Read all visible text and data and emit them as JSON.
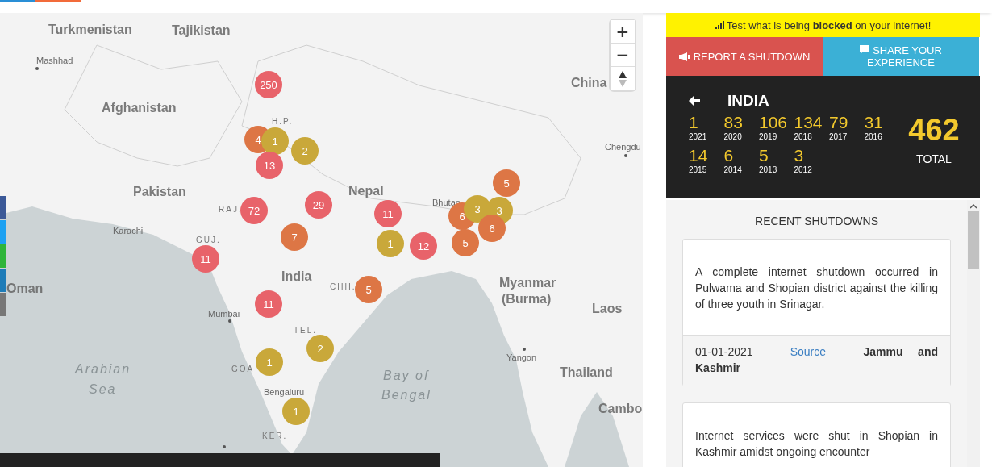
{
  "map": {
    "labels": [
      {
        "text": "Turkmenistan",
        "kind": "country"
      },
      {
        "text": "Tajikistan",
        "kind": "country"
      },
      {
        "text": "Mashhad",
        "kind": "city"
      },
      {
        "text": "Afghanistan",
        "kind": "country"
      },
      {
        "text": "China",
        "kind": "country"
      },
      {
        "text": "H.P.",
        "kind": "region"
      },
      {
        "text": "Chengdu",
        "kind": "city"
      },
      {
        "text": "Pakistan",
        "kind": "country"
      },
      {
        "text": "Nepal",
        "kind": "country"
      },
      {
        "text": "RAJ.",
        "kind": "region"
      },
      {
        "text": "Bhutan",
        "kind": "small"
      },
      {
        "text": "Karachi",
        "kind": "city"
      },
      {
        "text": "GUJ.",
        "kind": "region"
      },
      {
        "text": "India",
        "kind": "country"
      },
      {
        "text": "Oman",
        "kind": "country"
      },
      {
        "text": "CHH.",
        "kind": "region"
      },
      {
        "text": "Myanmar",
        "kind": "country"
      },
      {
        "text": "(Burma)",
        "kind": "country"
      },
      {
        "text": "Mumbai",
        "kind": "city"
      },
      {
        "text": "Laos",
        "kind": "country"
      },
      {
        "text": "TEL.",
        "kind": "region"
      },
      {
        "text": "Yangon",
        "kind": "city"
      },
      {
        "text": "Arabian",
        "kind": "sea"
      },
      {
        "text": "Sea",
        "kind": "sea"
      },
      {
        "text": "GOA",
        "kind": "region"
      },
      {
        "text": "Bay of",
        "kind": "sea"
      },
      {
        "text": "Thailand",
        "kind": "country"
      },
      {
        "text": "Bengaluru",
        "kind": "city"
      },
      {
        "text": "Bengal",
        "kind": "sea"
      },
      {
        "text": "Cambo",
        "kind": "country"
      },
      {
        "text": "KER.",
        "kind": "region"
      }
    ],
    "markers": [
      {
        "count": "250",
        "color": "#e8636a"
      },
      {
        "count": "4",
        "color": "#dd7645"
      },
      {
        "count": "1",
        "color": "#c9a83a"
      },
      {
        "count": "2",
        "color": "#c9a83a"
      },
      {
        "count": "13",
        "color": "#e8636a"
      },
      {
        "count": "5",
        "color": "#dd7645"
      },
      {
        "count": "29",
        "color": "#e8636a"
      },
      {
        "count": "72",
        "color": "#e8636a"
      },
      {
        "count": "11",
        "color": "#e8636a"
      },
      {
        "count": "6",
        "color": "#dd7645"
      },
      {
        "count": "3",
        "color": "#c9a83a"
      },
      {
        "count": "3",
        "color": "#c9a83a"
      },
      {
        "count": "6",
        "color": "#dd7645"
      },
      {
        "count": "7",
        "color": "#dd7645"
      },
      {
        "count": "1",
        "color": "#c9a83a"
      },
      {
        "count": "12",
        "color": "#e8636a"
      },
      {
        "count": "5",
        "color": "#dd7645"
      },
      {
        "count": "11",
        "color": "#e8636a"
      },
      {
        "count": "5",
        "color": "#dd7645"
      },
      {
        "count": "11",
        "color": "#e8636a"
      },
      {
        "count": "2",
        "color": "#c9a83a"
      },
      {
        "count": "1",
        "color": "#c9a83a"
      },
      {
        "count": "1",
        "color": "#c9a83a"
      }
    ],
    "controls": {
      "zoom_in": "+",
      "zoom_out": "−"
    },
    "share_buttons": [
      {
        "color": "#3b5998"
      },
      {
        "color": "#1da1f2"
      },
      {
        "color": "#2fb53a"
      },
      {
        "color": "#1e7cb8"
      },
      {
        "color": "#777777"
      }
    ]
  },
  "sidebar": {
    "banner": "Test what is being **blocked** on your internet!",
    "report_button": "REPORT A SHUTDOWN",
    "share_button": "SHARE YOUR EXPERIENCE",
    "country": "INDIA",
    "years": [
      {
        "value": "1",
        "year": "2021"
      },
      {
        "value": "83",
        "year": "2020"
      },
      {
        "value": "106",
        "year": "2019"
      },
      {
        "value": "134",
        "year": "2018"
      },
      {
        "value": "79",
        "year": "2017"
      },
      {
        "value": "31",
        "year": "2016"
      },
      {
        "value": "14",
        "year": "2015"
      },
      {
        "value": "6",
        "year": "2014"
      },
      {
        "value": "5",
        "year": "2013"
      },
      {
        "value": "3",
        "year": "2012"
      }
    ],
    "total": "462",
    "total_label": "TOTAL",
    "recent_title": "RECENT SHUTDOWNS",
    "shutdowns": [
      {
        "text": "A complete internet shutdown occurred in Pulwama and Shopian district against the killing of three youth in Srinagar.",
        "date": "01-01-2021",
        "source": "Source",
        "region": "Jammu and Kashmir"
      },
      {
        "text": "Internet services were shut in Shopian in Kashmir amidst ongoing encounter"
      }
    ]
  }
}
